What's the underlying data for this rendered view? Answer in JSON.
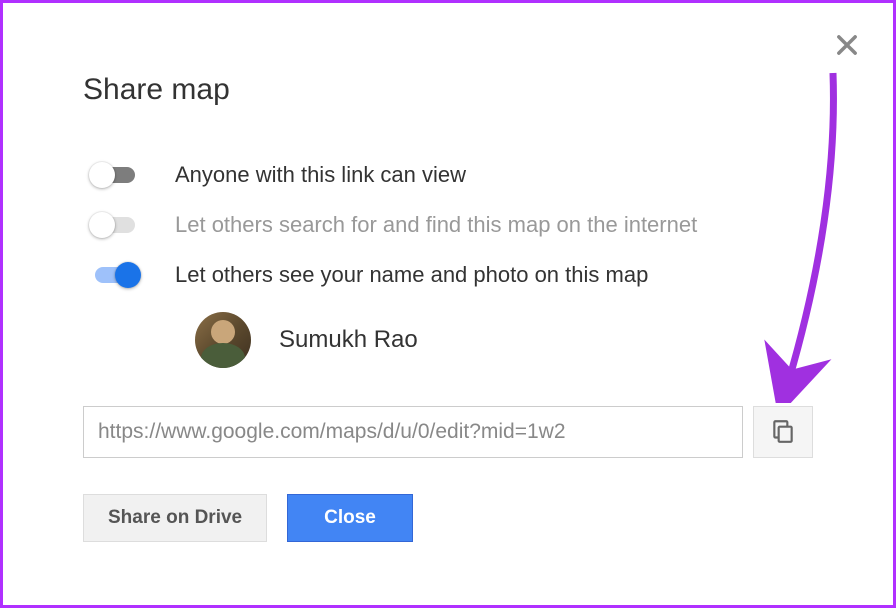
{
  "dialog": {
    "title": "Share map",
    "toggles": [
      {
        "label": "Anyone with this link can view",
        "state": "off-dark",
        "enabled": true
      },
      {
        "label": "Let others search for and find this map on the internet",
        "state": "off-light",
        "enabled": false
      },
      {
        "label": "Let others see your name and photo on this map",
        "state": "on",
        "enabled": true
      }
    ],
    "profile": {
      "name": "Sumukh Rao"
    },
    "share_url": "https://www.google.com/maps/d/u/0/edit?mid=1w2",
    "buttons": {
      "share_on_drive": "Share on Drive",
      "close": "Close"
    }
  }
}
